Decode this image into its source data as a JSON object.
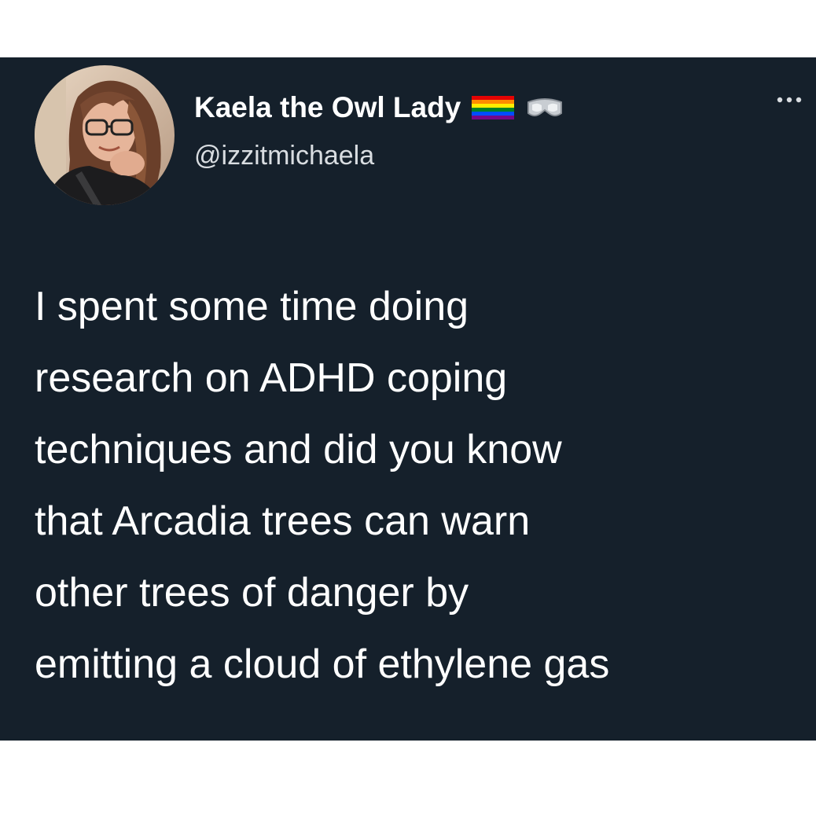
{
  "tweet": {
    "author": {
      "display_name": "Kaela the Owl Lady",
      "handle": "@izzitmichaela",
      "badges": [
        "rainbow-flag-icon",
        "goggles-icon"
      ]
    },
    "more_icon": "more-options-icon",
    "text_lines": [
      "I spent some time doing",
      "research on ADHD coping",
      "techniques and did you know",
      "that Arcadia trees can warn",
      "other trees of danger by",
      "emitting a cloud of ethylene gas"
    ]
  },
  "colors": {
    "card_background": "#15202b",
    "page_background": "#ffffff",
    "text_primary": "#ffffff",
    "text_secondary": "#d9dde1"
  }
}
